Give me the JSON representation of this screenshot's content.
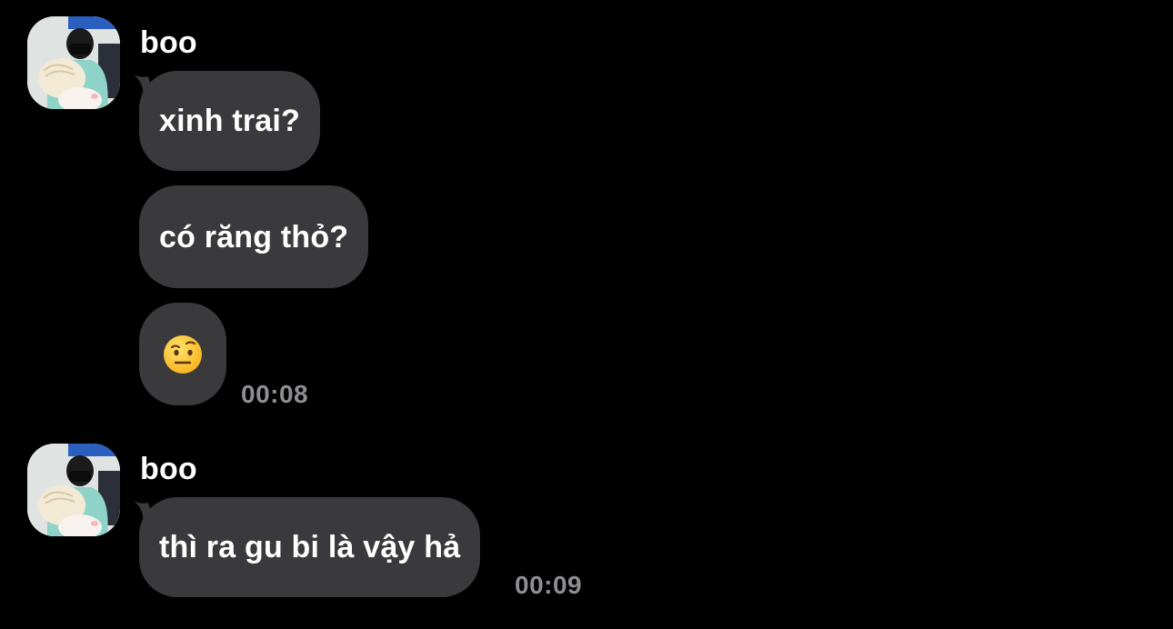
{
  "groups": [
    {
      "sender": "boo",
      "messages": [
        {
          "text": "xinh trai?"
        },
        {
          "text": "có răng thỏ?"
        },
        {
          "emoji": "face-with-raised-eyebrow"
        }
      ],
      "time": "00:08"
    },
    {
      "sender": "boo",
      "messages": [
        {
          "text": "thì ra gu bi là vậy hả"
        }
      ],
      "time": "00:09"
    }
  ],
  "colors": {
    "background": "#000000",
    "bubble": "#3a3a3c",
    "text": "#ffffff",
    "timestamp": "#8e8e93"
  }
}
